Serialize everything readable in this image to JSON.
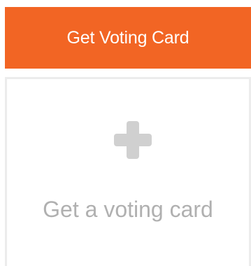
{
  "header_button": {
    "label": "Get Voting Card"
  },
  "card_tile": {
    "icon": "plus-icon",
    "label": "Get a voting card"
  },
  "colors": {
    "accent": "#f26524",
    "tile_border": "#ececec",
    "icon": "#d0d0d0",
    "tile_text": "#b0b0b0"
  }
}
